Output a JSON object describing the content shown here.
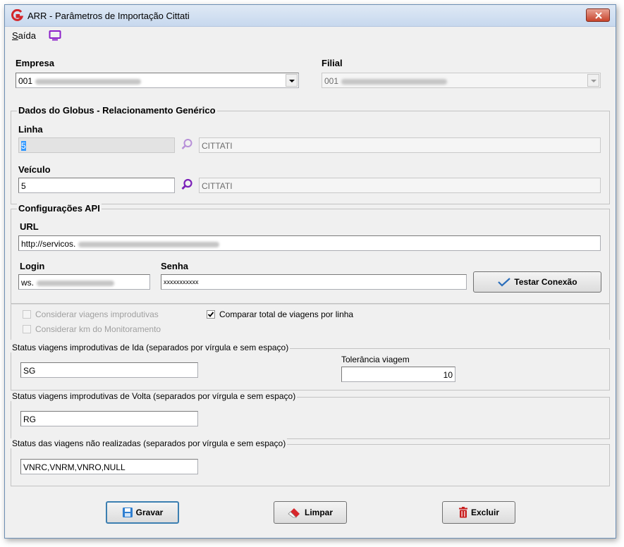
{
  "window": {
    "title": "ARR - Parâmetros de Importação Cittati"
  },
  "menu": {
    "exit_accel": "S",
    "exit_rest": "aída"
  },
  "empresa": {
    "label": "Empresa",
    "code": "001"
  },
  "filial": {
    "label": "Filial",
    "code": "001"
  },
  "globus": {
    "title": "Dados do Globus - Relacionamento Genérico",
    "linha_label": "Linha",
    "linha_code": "5",
    "linha_desc": "CITTATI",
    "veiculo_label": "Veículo",
    "veiculo_code": "5",
    "veiculo_desc": "CITTATI"
  },
  "api": {
    "title": "Configurações API",
    "url_label": "URL",
    "url_value": "http://servicos.",
    "login_label": "Login",
    "login_value": "ws.",
    "senha_label": "Senha",
    "senha_value": "xxxxxxxxxxx",
    "test_button": "Testar Conexão"
  },
  "options": {
    "considerar_improdutivas": "Considerar viagens improdutivas",
    "considerar_km": "Considerar km do Monitoramento",
    "comparar_total": "Comparar total de viagens por linha"
  },
  "ida": {
    "title": "Status viagens improdutivas de Ida (separados por vírgula e sem espaço)",
    "value": "SG",
    "tolerancia_label": "Tolerância viagem",
    "tolerancia_value": "10"
  },
  "volta": {
    "title": "Status viagens improdutivas de Volta (separados por vírgula e sem espaço)",
    "value": "RG"
  },
  "nao_realizadas": {
    "title": "Status das viagens não realizadas (separados por vírgula e sem espaço)",
    "value": "VNRC,VNRM,VNRO,NULL"
  },
  "buttons": {
    "save": "Gravar",
    "clear": "Limpar",
    "delete": "Excluir"
  },
  "colors": {
    "accent_purple": "#7a1fb8",
    "title_bar": "#c7d8ee",
    "close_red": "#c8442c"
  }
}
